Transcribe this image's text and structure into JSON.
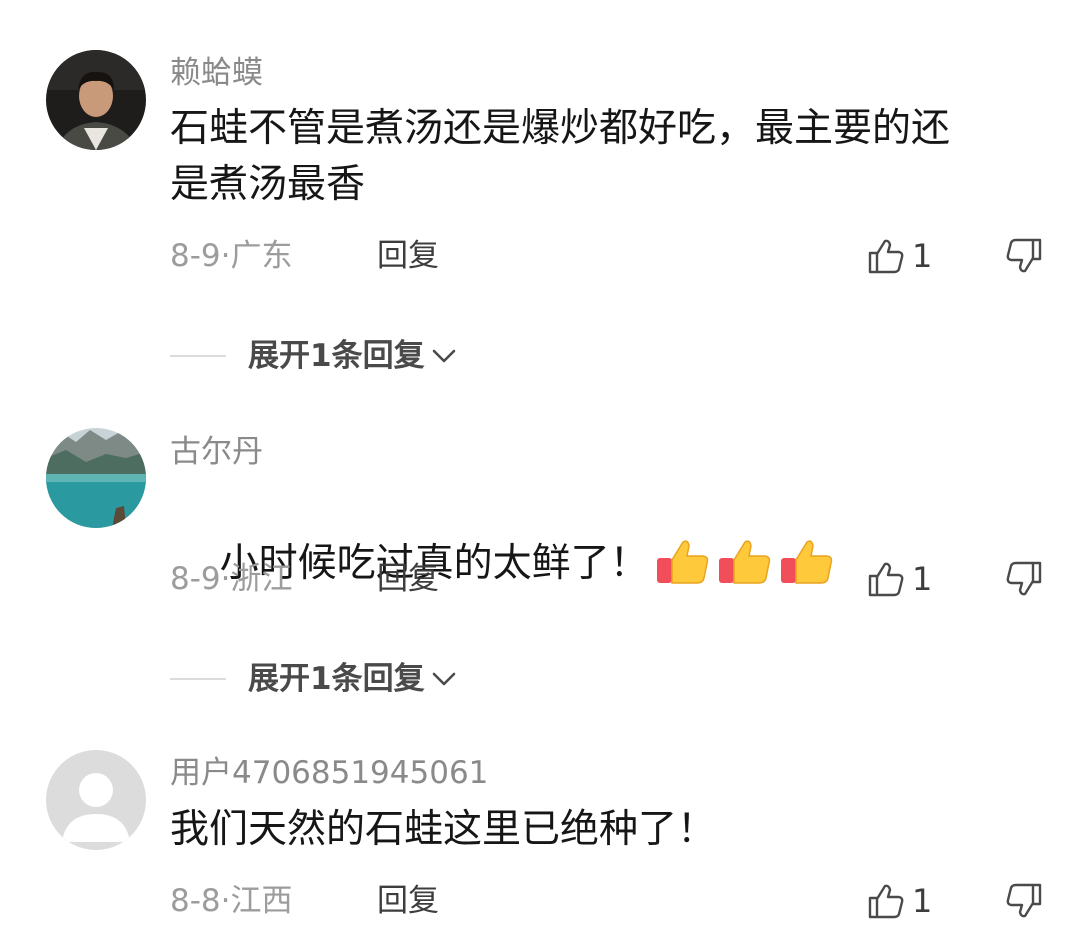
{
  "comments": [
    {
      "username": "赖蛤蟆",
      "text": "石蛙不管是煮汤还是爆炒都好吃，最主要的还\n是煮汤最香",
      "date": "8-9·",
      "region": "广东",
      "reply_label": "回复",
      "likes": "1",
      "expand_label": "展开1条回复",
      "avatar_icon": "person-photo-avatar"
    },
    {
      "username": "古尔丹",
      "text": "小时候吃过真的太鲜了！",
      "emojis": [
        "thumbs-up-emoji",
        "thumbs-up-emoji",
        "thumbs-up-emoji"
      ],
      "date": "8-9·",
      "region": "浙江",
      "reply_label": "回复",
      "likes": "1",
      "expand_label": "展开1条回复",
      "avatar_icon": "lake-landscape-avatar"
    },
    {
      "username": "用户4706851945061",
      "text": "我们天然的石蛙这里已绝种了！",
      "date": "8-8·",
      "region": "江西",
      "reply_label": "回复",
      "likes": "1",
      "avatar_icon": "default-user-avatar"
    }
  ],
  "icons": {
    "like": "thumbs-up-outline-icon",
    "dislike": "thumbs-down-outline-icon",
    "expand": "chevron-down-icon"
  },
  "colors": {
    "username": "#8a8a8a",
    "text": "#161616",
    "meta": "#9c9c9c",
    "action": "#3d3d3d"
  }
}
